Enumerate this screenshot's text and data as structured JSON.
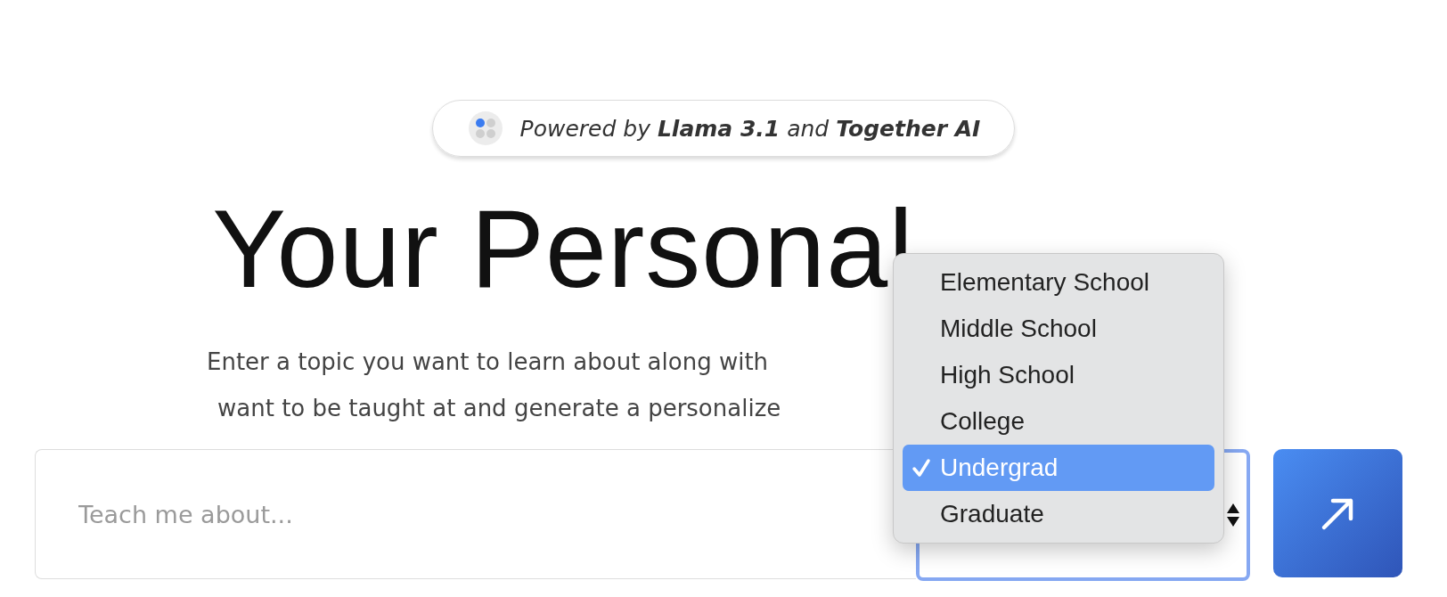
{
  "badge": {
    "text": "Powered by **Llama 3.1** and **Together AI**"
  },
  "heading": {
    "text": "Your Personal"
  },
  "description": [
    "Enter a topic you want to learn about along with",
    "want to be taught at and generate a personalize"
  ],
  "search": {
    "placeholder": "Teach me about..."
  },
  "level_select": {
    "expanded": true,
    "options": [
      {
        "label": "Elementary School",
        "selected": false
      },
      {
        "label": "Middle School",
        "selected": false
      },
      {
        "label": "High School",
        "selected": false
      },
      {
        "label": "College",
        "selected": false
      },
      {
        "label": "Undergrad",
        "selected": true
      },
      {
        "label": "Graduate",
        "selected": false
      }
    ]
  }
}
